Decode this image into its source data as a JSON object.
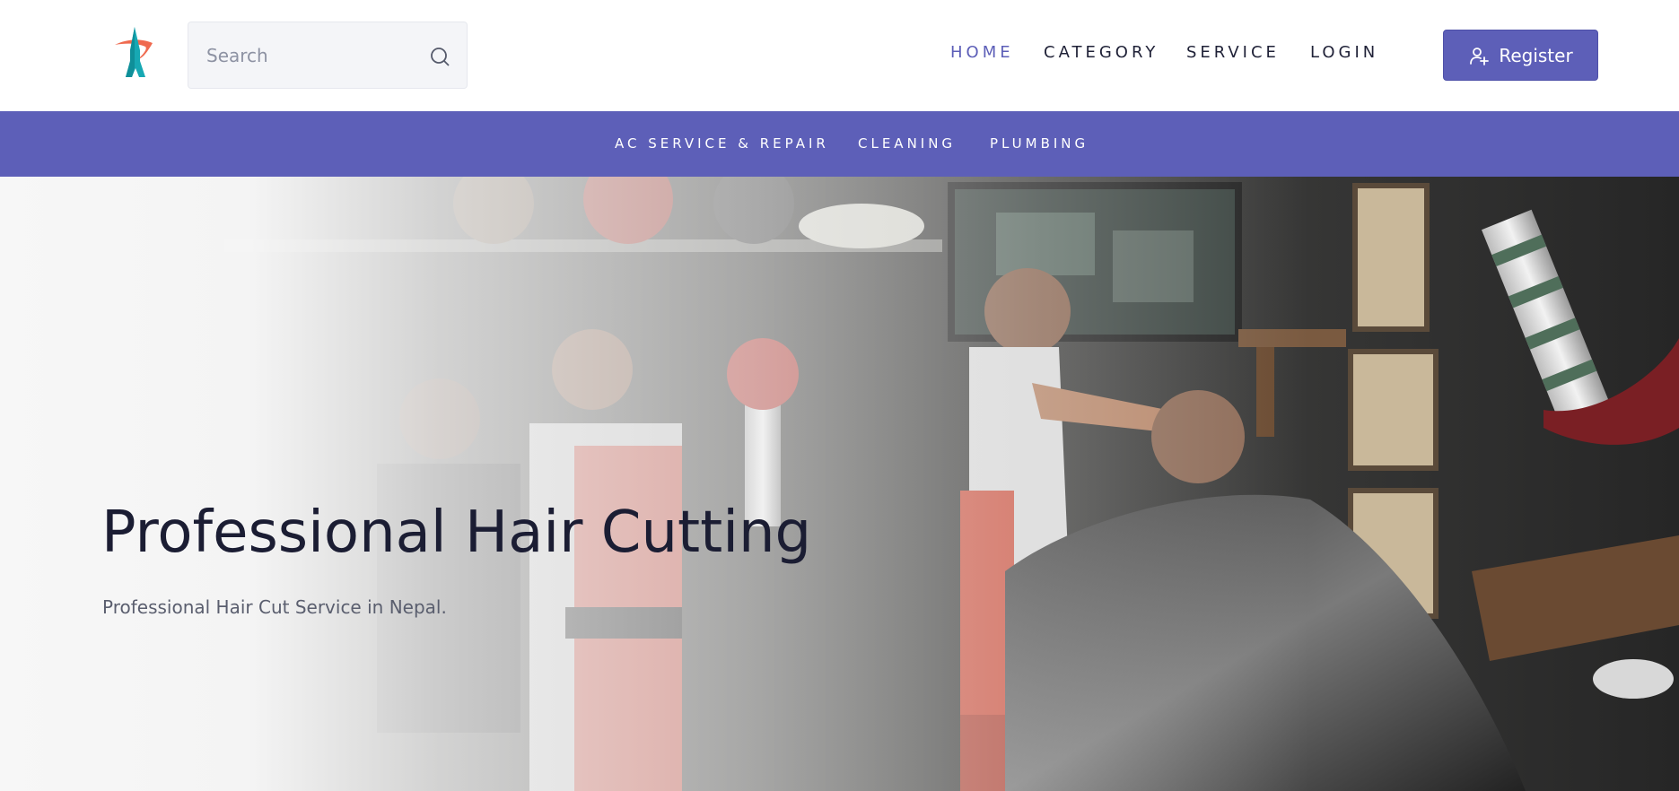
{
  "brand": {
    "logo_icon": "rocket-logo-icon",
    "accent_color": "#5d5fb8"
  },
  "search": {
    "placeholder": "Search",
    "value": "",
    "icon": "search-icon"
  },
  "nav": {
    "items": [
      {
        "label": "HOME",
        "active": true
      },
      {
        "label": "CATEGORY",
        "active": false
      },
      {
        "label": "SERVICE",
        "active": false
      },
      {
        "label": "LOGIN",
        "active": false
      }
    ],
    "register_label": "Register",
    "register_icon": "user-plus-icon"
  },
  "subnav": {
    "items": [
      {
        "label": "AC SERVICE & REPAIR"
      },
      {
        "label": "CLEANING"
      },
      {
        "label": "PLUMBING"
      }
    ]
  },
  "hero": {
    "title": "Professional Hair Cutting",
    "subtitle": "Professional Hair Cut Service in Nepal.",
    "image": "barbershop-photo"
  }
}
